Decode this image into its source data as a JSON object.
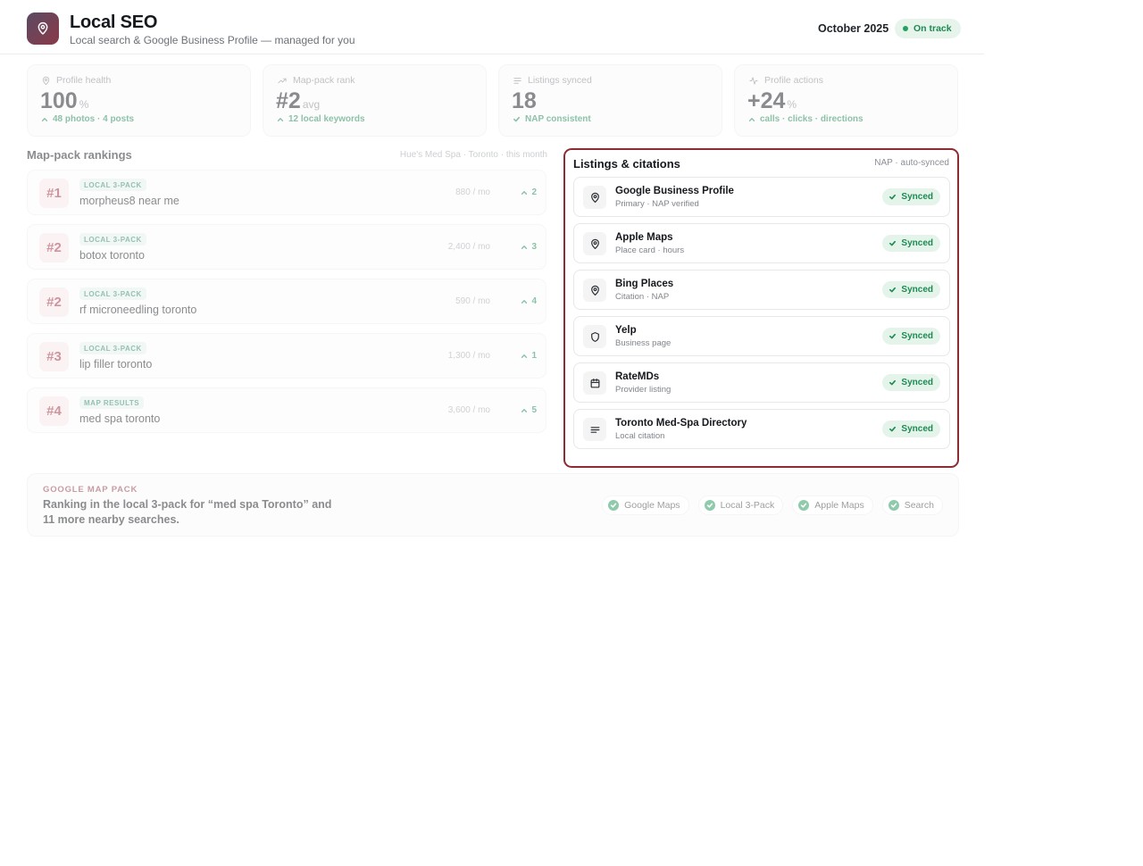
{
  "header": {
    "title": "Local SEO",
    "subtitle": "Local search & Google Business Profile — managed for you",
    "period": "October 2025",
    "status": "On track",
    "icons": {
      "logo": "map-pin-icon"
    }
  },
  "kpis": [
    {
      "label": "Profile health",
      "value": "100",
      "unit": "%",
      "sub": "48 photos · 4 posts",
      "icon": "map-pin-icon"
    },
    {
      "label": "Map-pack rank",
      "value": "#2",
      "unit": "avg",
      "sub": "12 local keywords",
      "icon": "trend-up-icon"
    },
    {
      "label": "Listings synced",
      "value": "18",
      "unit": "",
      "sub": "NAP consistent",
      "icon": "lines-icon"
    },
    {
      "label": "Profile actions",
      "value": "+24",
      "unit": "%",
      "sub": "calls · clicks · directions",
      "icon": "activity-icon"
    }
  ],
  "rankings": {
    "title": "Map-pack rankings",
    "meta": "Hue's Med Spa · Toronto · this month",
    "rows": [
      {
        "rank": "#1",
        "tag": "LOCAL 3-PACK",
        "keyword": "morpheus8 near me",
        "volume": "880 / mo",
        "delta": "2"
      },
      {
        "rank": "#2",
        "tag": "LOCAL 3-PACK",
        "keyword": "botox toronto",
        "volume": "2,400 / mo",
        "delta": "3"
      },
      {
        "rank": "#2",
        "tag": "LOCAL 3-PACK",
        "keyword": "rf microneedling toronto",
        "volume": "590 / mo",
        "delta": "4"
      },
      {
        "rank": "#3",
        "tag": "LOCAL 3-PACK",
        "keyword": "lip filler toronto",
        "volume": "1,300 / mo",
        "delta": "1"
      },
      {
        "rank": "#4",
        "tag": "MAP RESULTS",
        "keyword": "med spa toronto",
        "volume": "3,600 / mo",
        "delta": "5"
      }
    ]
  },
  "listings": {
    "title": "Listings & citations",
    "meta": "NAP · auto-synced",
    "items": [
      {
        "name": "Google Business Profile",
        "sub": "Primary · NAP verified",
        "status": "Synced",
        "icon": "map-pin-icon"
      },
      {
        "name": "Apple Maps",
        "sub": "Place card · hours",
        "status": "Synced",
        "icon": "map-pin-icon"
      },
      {
        "name": "Bing Places",
        "sub": "Citation · NAP",
        "status": "Synced",
        "icon": "map-pin-icon"
      },
      {
        "name": "Yelp",
        "sub": "Business page",
        "status": "Synced",
        "icon": "shield-icon"
      },
      {
        "name": "RateMDs",
        "sub": "Provider listing",
        "status": "Synced",
        "icon": "calendar-icon"
      },
      {
        "name": "Toronto Med-Spa Directory",
        "sub": "Local citation",
        "status": "Synced",
        "icon": "lines-icon"
      }
    ]
  },
  "footer": {
    "kicker": "GOOGLE MAP PACK",
    "headline": "Ranking in the local 3-pack for “med spa Toronto” and 11 more nearby searches.",
    "chips": [
      "Google Maps",
      "Local 3-Pack",
      "Apple Maps",
      "Search"
    ]
  },
  "colors": {
    "accent": "#8e2b33",
    "success": "#1e8a52",
    "success_bg": "#e4f4ea",
    "rank_badge_bg": "#f6e9eb"
  }
}
